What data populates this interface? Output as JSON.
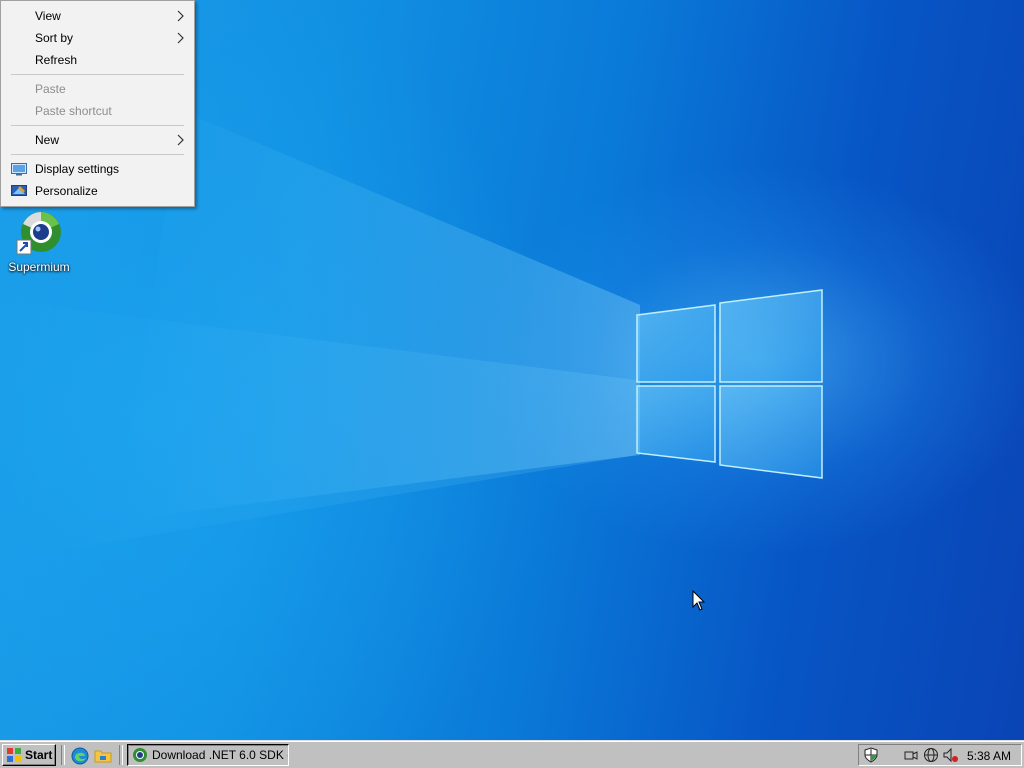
{
  "desktop": {
    "icons": [
      {
        "label": "Supermium",
        "icon": "supermium-browser-icon"
      }
    ]
  },
  "context_menu": {
    "items": [
      {
        "label": "View",
        "submenu": true,
        "enabled": true
      },
      {
        "label": "Sort by",
        "submenu": true,
        "enabled": true
      },
      {
        "label": "Refresh",
        "submenu": false,
        "enabled": true
      },
      {
        "label": "Paste",
        "submenu": false,
        "enabled": false
      },
      {
        "label": "Paste shortcut",
        "submenu": false,
        "enabled": false
      },
      {
        "label": "New",
        "submenu": true,
        "enabled": true
      },
      {
        "label": "Display settings",
        "icon": "display-settings-icon",
        "enabled": true
      },
      {
        "label": "Personalize",
        "icon": "personalize-icon",
        "enabled": true
      }
    ]
  },
  "taskbar": {
    "start_label": "Start",
    "quick_launch": [
      {
        "name": "edge-icon"
      },
      {
        "name": "file-explorer-icon"
      }
    ],
    "tasks": [
      {
        "label": "Download .NET 6.0 SDK (...",
        "icon": "supermium-browser-icon"
      }
    ],
    "tray": {
      "icons": [
        "security-shield-icon",
        "meet-now-icon",
        "network-globe-icon",
        "volume-muted-icon"
      ],
      "clock": "5:38 AM"
    }
  },
  "colors": {
    "wallpaper_light": "#1b9be6",
    "wallpaper_dark": "#0a44b5",
    "taskbar": "#c0c0c0",
    "menu_bg": "#f2f2f2"
  }
}
